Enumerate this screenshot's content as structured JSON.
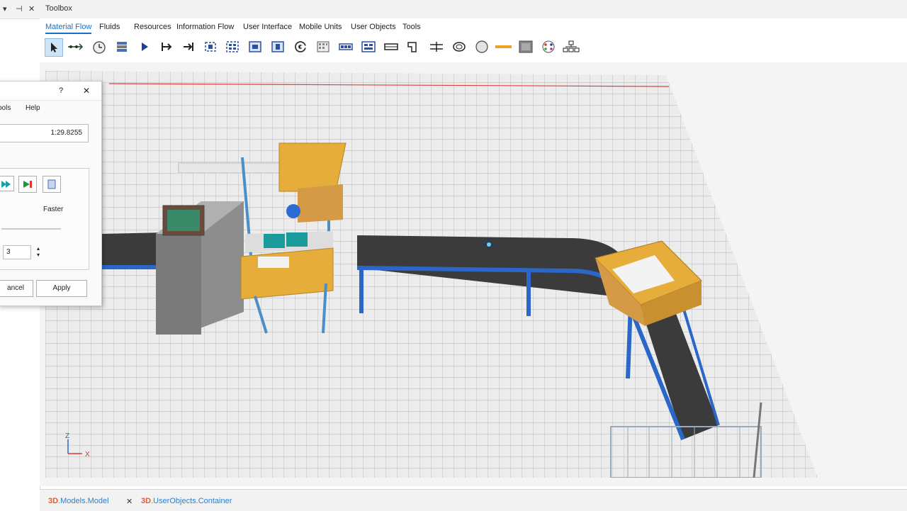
{
  "left_panel": {
    "pin_glyph": "▾",
    "dock_glyph": "⊣",
    "close_glyph": "✕"
  },
  "toolbox": {
    "title": "Toolbox",
    "tabs": [
      "Material Flow",
      "Fluids",
      "Resources",
      "Information Flow",
      "User Interface",
      "Mobile Units",
      "User Objects",
      "Tools"
    ],
    "active_tab": "Material Flow",
    "tools": [
      "pointer-icon",
      "connector-icon",
      "clock-icon",
      "event-controller-icon",
      "play-arrow-icon",
      "source-icon",
      "drain-icon",
      "single-proc-icon",
      "parallel-proc-icon",
      "assembly-icon",
      "dismantle-icon",
      "cycle-icon",
      "store-icon",
      "buffer-icon",
      "sorter-icon",
      "line-icon",
      "angular-converter-icon",
      "turntable-icon",
      "turnplate-icon",
      "track-icon",
      "circle-icon",
      "flow-icon",
      "grid-icon",
      "node-icon",
      "network-icon"
    ]
  },
  "speed_dialog": {
    "help_glyph": "?",
    "close_glyph": "✕",
    "menu": [
      "ools",
      "Help"
    ],
    "time": "1:29.8255",
    "faster_label": "Faster",
    "spin_value": "3",
    "cancel_label": "ancel",
    "apply_label": "Apply"
  },
  "bottom_tabs": [
    {
      "prefix": "3D",
      "rest": ".Models.Model",
      "close": "✕"
    },
    {
      "prefix": "3D",
      "rest": ".UserObjects.Container",
      "close": ""
    }
  ],
  "viewport": {
    "axis_z": "Z",
    "axis_x": "X"
  },
  "colors": {
    "accent": "#1a6fc4",
    "conveyor": "#3b3b3b",
    "frame": "#2b67c9",
    "box": "#e6ad3a",
    "grid_line": "#9a9a9a"
  }
}
